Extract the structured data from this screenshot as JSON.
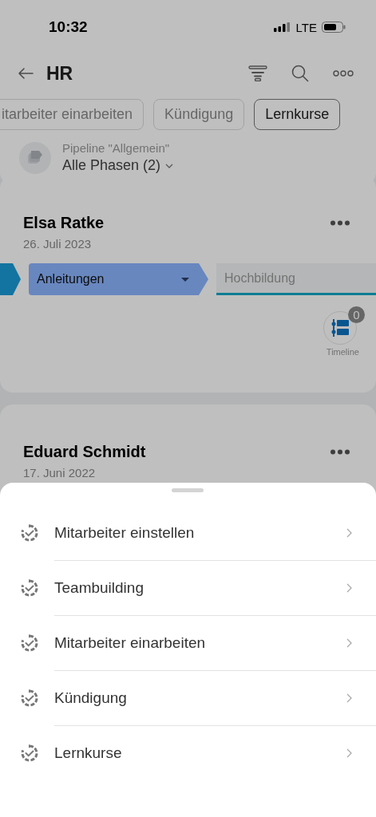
{
  "status_bar": {
    "time": "10:32",
    "network": "LTE"
  },
  "header": {
    "title": "HR"
  },
  "filter_chips": [
    {
      "label": "itarbeiter einarbeiten",
      "selected": false
    },
    {
      "label": "Kündigung",
      "selected": false
    },
    {
      "label": "Lernkurse",
      "selected": true
    }
  ],
  "pipeline": {
    "label": "Pipeline \"Allgemein\"",
    "phase": "Alle Phasen (2)"
  },
  "cards": [
    {
      "name": "Elsa Ratke",
      "date": "26. Juli 2023",
      "stages": [
        {
          "kind": "done"
        },
        {
          "kind": "current",
          "label": "Anleitungen"
        },
        {
          "kind": "next",
          "label": "Hochbildung"
        }
      ],
      "timeline": {
        "count": "0",
        "label": "Timeline"
      }
    },
    {
      "name": "Eduard Schmidt",
      "date": "17. Juni 2022"
    }
  ],
  "sheet": {
    "items": [
      {
        "label": "Mitarbeiter einstellen"
      },
      {
        "label": "Teambuilding"
      },
      {
        "label": "Mitarbeiter einarbeiten"
      },
      {
        "label": "Kündigung"
      },
      {
        "label": "Lernkurse"
      }
    ]
  }
}
